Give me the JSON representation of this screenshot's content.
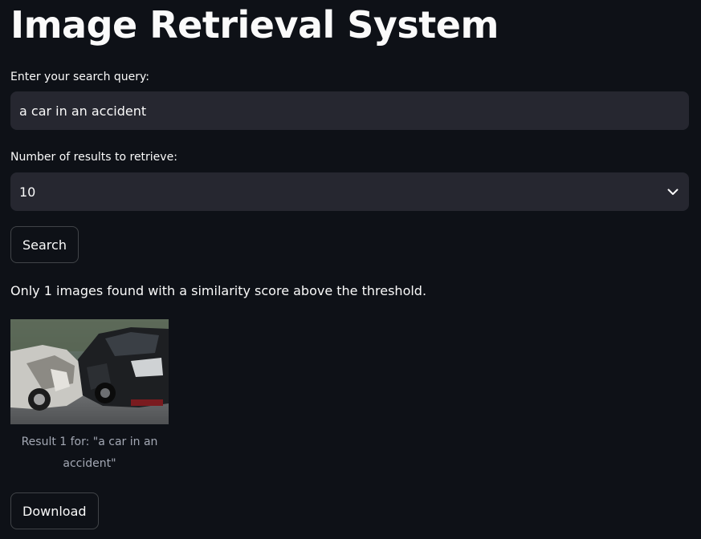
{
  "page": {
    "title": "Image Retrieval System"
  },
  "search": {
    "query_label": "Enter your search query:",
    "query_value": "a car in an accident",
    "count_label": "Number of results to retrieve:",
    "count_value": "10",
    "search_button": "Search"
  },
  "results": {
    "status_message": "Only 1 images found with a similarity score above the threshold.",
    "items": [
      {
        "caption": "Result 1 for: \"a car in an accident\""
      }
    ],
    "download_button": "Download"
  },
  "colors": {
    "background": "#0e1117",
    "input_background": "#262730",
    "text": "#fafafa",
    "caption_text": "#a3a8b4"
  },
  "icons": {
    "select_chevron": "chevron-down-icon"
  }
}
